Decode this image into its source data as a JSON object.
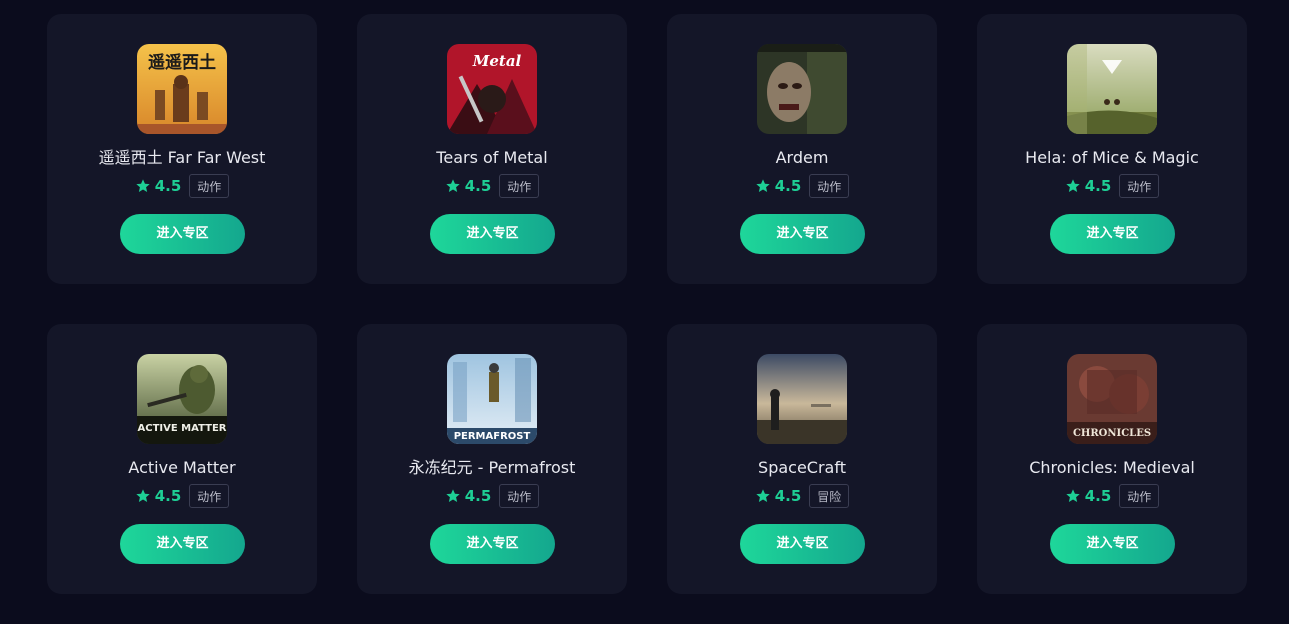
{
  "colors": {
    "background": "#0b0c1d",
    "card": "#141628",
    "accent": "#1ecf95",
    "button_gradient_start": "#1ed79a",
    "button_gradient_end": "#14a78e"
  },
  "games": [
    {
      "title": "遥遥西土 Far Far West",
      "rating": "4.5",
      "tag": "动作",
      "button_label": "进入专区",
      "cover_text": "遥遥西土",
      "star_icon": "star-icon"
    },
    {
      "title": "Tears of Metal",
      "rating": "4.5",
      "tag": "动作",
      "button_label": "进入专区",
      "cover_text": "Metal",
      "star_icon": "star-icon"
    },
    {
      "title": "Ardem",
      "rating": "4.5",
      "tag": "动作",
      "button_label": "进入专区",
      "cover_text": "",
      "star_icon": "star-icon"
    },
    {
      "title": "Hela: of Mice & Magic",
      "rating": "4.5",
      "tag": "动作",
      "button_label": "进入专区",
      "cover_text": "",
      "star_icon": "star-icon"
    },
    {
      "title": "Active Matter",
      "rating": "4.5",
      "tag": "动作",
      "button_label": "进入专区",
      "cover_text": "ACTIVE MATTER",
      "star_icon": "star-icon"
    },
    {
      "title": "永冻纪元 - Permafrost",
      "rating": "4.5",
      "tag": "动作",
      "button_label": "进入专区",
      "cover_text": "PERMAFROST",
      "star_icon": "star-icon"
    },
    {
      "title": "SpaceCraft",
      "rating": "4.5",
      "tag": "冒险",
      "button_label": "进入专区",
      "cover_text": "",
      "star_icon": "star-icon"
    },
    {
      "title": "Chronicles: Medieval",
      "rating": "4.5",
      "tag": "动作",
      "button_label": "进入专区",
      "cover_text": "CHRONICLES",
      "star_icon": "star-icon"
    }
  ]
}
